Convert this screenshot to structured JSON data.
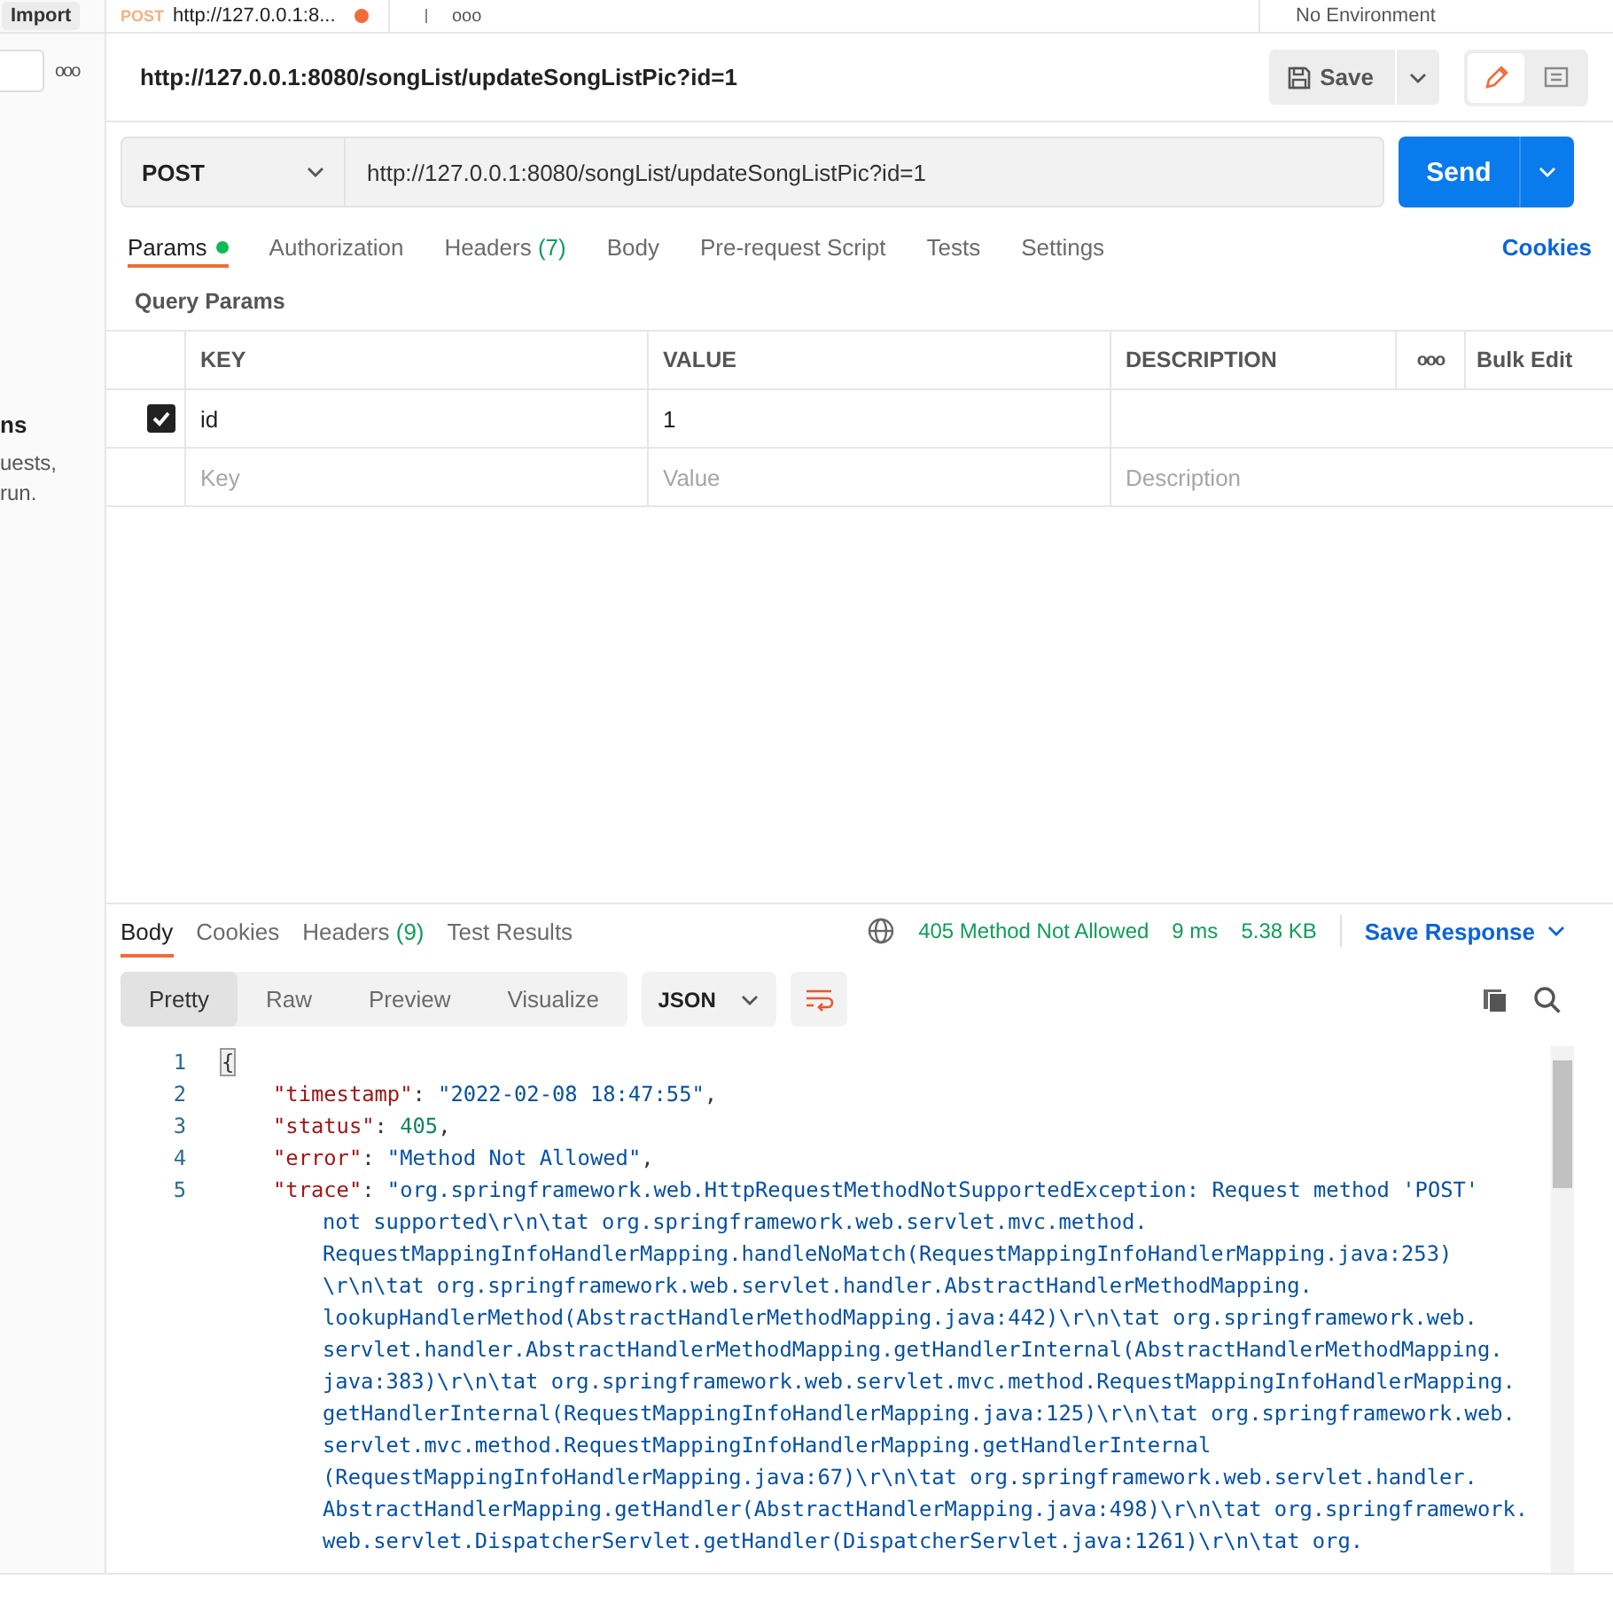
{
  "top_bar": {
    "import_button": "Import",
    "request_tab": {
      "method": "POST",
      "title": "http://127.0.0.1:8...",
      "unsaved": true
    },
    "more": "ooo",
    "environment": "No Environment"
  },
  "sidebar": {
    "more": "ooo",
    "texts": [
      "ns",
      "uests,",
      "run."
    ]
  },
  "request": {
    "title": "http://127.0.0.1:8080/songList/updateSongListPic?id=1",
    "save": "Save",
    "method": "POST",
    "url": "http://127.0.0.1:8080/songList/updateSongListPic?id=1",
    "send": "Send",
    "tabs": [
      {
        "label": "Params",
        "dot": true,
        "selected": true
      },
      {
        "label": "Authorization",
        "dot": false,
        "selected": false
      },
      {
        "label": "Headers",
        "count": "(7)",
        "dot": false,
        "selected": false
      },
      {
        "label": "Body",
        "dot": false,
        "selected": false
      },
      {
        "label": "Pre-request Script",
        "dot": false,
        "selected": false
      },
      {
        "label": "Tests",
        "dot": false,
        "selected": false
      },
      {
        "label": "Settings",
        "dot": false,
        "selected": false
      }
    ],
    "cookies": "Cookies",
    "section": "Query Params",
    "table": {
      "columns": [
        "KEY",
        "VALUE",
        "DESCRIPTION"
      ],
      "more": "ooo",
      "bulk_edit": "Bulk Edit",
      "rows": [
        {
          "checked": true,
          "key": "id",
          "value": "1",
          "description": ""
        }
      ],
      "new_row": [
        {
          "placeholder": "Key"
        },
        {
          "placeholder": "Value"
        },
        {
          "placeholder": "Description"
        }
      ]
    }
  },
  "response": {
    "tabs": [
      {
        "label": "Body",
        "selected": true
      },
      {
        "label": "Cookies",
        "selected": false
      },
      {
        "label": "Headers",
        "count": "(9)",
        "selected": false
      },
      {
        "label": "Test Results",
        "selected": false
      }
    ],
    "status": "405 Method Not Allowed",
    "time": "9 ms",
    "size": "5.38 KB",
    "save_response": "Save Response",
    "views": [
      {
        "label": "Pretty",
        "selected": true
      },
      {
        "label": "Raw",
        "selected": false
      },
      {
        "label": "Preview",
        "selected": false
      },
      {
        "label": "Visualize",
        "selected": false
      }
    ],
    "format": "JSON",
    "code": [
      {
        "number": "1",
        "segments": [
          {
            "kind": "brace",
            "text": "{"
          }
        ]
      },
      {
        "number": "2",
        "segments": [
          {
            "kind": "key",
            "text": "\"timestamp\""
          },
          {
            "kind": "punct",
            "text": ":"
          },
          {
            "kind": "string",
            "text": "\"2022-02-08 18:47:55\""
          },
          {
            "kind": "punct",
            "text": ","
          }
        ]
      },
      {
        "number": "3",
        "segments": [
          {
            "kind": "key",
            "text": "\"status\""
          },
          {
            "kind": "punct",
            "text": ":"
          },
          {
            "kind": "number",
            "text": "405"
          },
          {
            "kind": "punct",
            "text": ","
          }
        ]
      },
      {
        "number": "4",
        "segments": [
          {
            "kind": "key",
            "text": "\"error\""
          },
          {
            "kind": "punct",
            "text": ":"
          },
          {
            "kind": "string",
            "text": "\"Method Not Allowed\""
          },
          {
            "kind": "punct",
            "text": ","
          }
        ]
      },
      {
        "number": "5",
        "segments": [
          {
            "kind": "key",
            "text": "\"trace\""
          },
          {
            "kind": "punct",
            "text": ":"
          },
          {
            "kind": "string",
            "text": "\"org.springframework.web.HttpRequestMethodNotSupportedException: Request method 'POST'"
          }
        ],
        "wrapped": [
          "not supported\\r\\n\\tat org.springframework.web.servlet.mvc.method.",
          "RequestMappingInfoHandlerMapping.handleNoMatch(RequestMappingInfoHandlerMapping.java:253)",
          "\\r\\n\\tat org.springframework.web.servlet.handler.AbstractHandlerMethodMapping.",
          "lookupHandlerMethod(AbstractHandlerMethodMapping.java:442)\\r\\n\\tat org.springframework.web.",
          "servlet.handler.AbstractHandlerMethodMapping.getHandlerInternal(AbstractHandlerMethodMapping.",
          "java:383)\\r\\n\\tat org.springframework.web.servlet.mvc.method.RequestMappingInfoHandlerMapping.",
          "getHandlerInternal(RequestMappingInfoHandlerMapping.java:125)\\r\\n\\tat org.springframework.web.",
          "servlet.mvc.method.RequestMappingInfoHandlerMapping.getHandlerInternal",
          "(RequestMappingInfoHandlerMapping.java:67)\\r\\n\\tat org.springframework.web.servlet.handler.",
          "AbstractHandlerMapping.getHandler(AbstractHandlerMapping.java:498)\\r\\n\\tat org.springframework.",
          "web.servlet.DispatcherServlet.getHandler(DispatcherServlet.java:1261)\\r\\n\\tat org."
        ]
      }
    ]
  }
}
